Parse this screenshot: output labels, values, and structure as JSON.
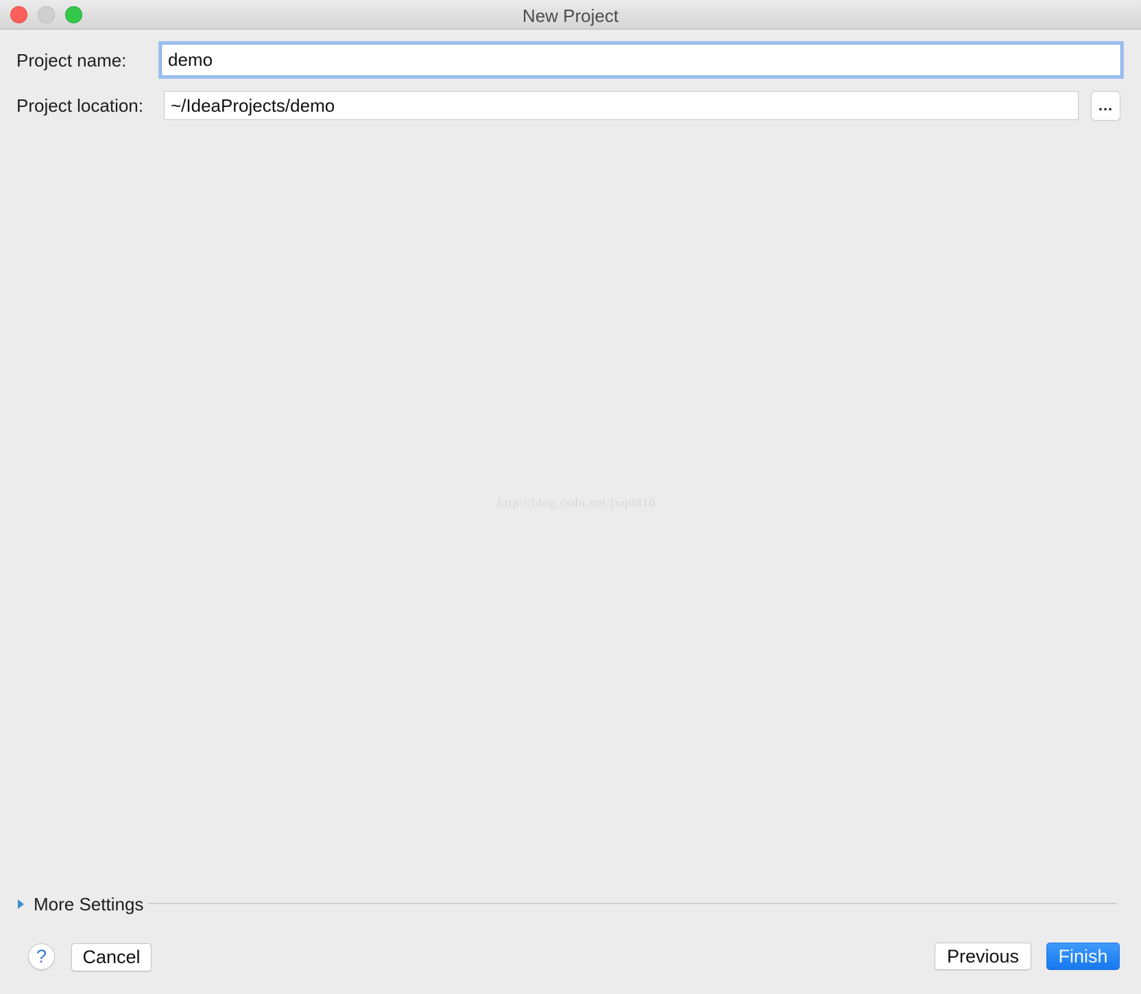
{
  "window": {
    "title": "New Project",
    "controls": {
      "close": "close-window",
      "minimize": "minimize-window",
      "maximize": "zoom-window"
    }
  },
  "form": {
    "project_name": {
      "label": "Project name:",
      "value": "demo"
    },
    "project_location": {
      "label": "Project location:",
      "value": "~/IdeaProjects/demo",
      "browse_label": "..."
    }
  },
  "watermark": "http://blog.csdn.net/jxq0816",
  "more_settings": {
    "label": "More Settings",
    "expanded": false
  },
  "footer": {
    "help_label": "?",
    "cancel_label": "Cancel",
    "previous_label": "Previous",
    "finish_label": "Finish"
  },
  "colors": {
    "accent": "#1677f0",
    "focus_ring": "#9cc0ee",
    "close": "#fc605b",
    "minimize": "#d0d0d0",
    "maximize": "#34c84a"
  }
}
